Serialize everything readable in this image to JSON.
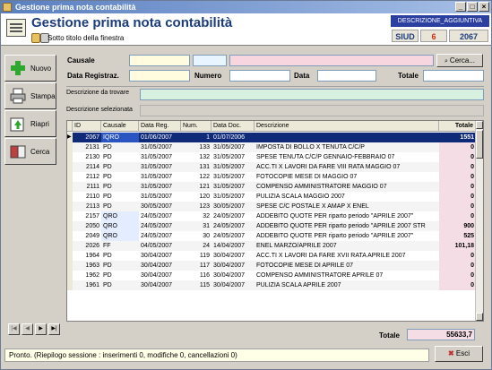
{
  "window": {
    "title": "Gestione prima nota contabilità"
  },
  "header": {
    "title": "Gestione prima nota contabilità",
    "subtitle": "Sotto titolo della finestra",
    "desc_badge": "DESCRIZIONE_AGGIUNTIVA",
    "siud": "SIUD",
    "count": "6",
    "year": "2067"
  },
  "sidebar": {
    "nuovo": "Nuovo",
    "stampa": "Stampa",
    "riapri": "Riapri",
    "cerca": "Cerca"
  },
  "filters": {
    "causale_label": "Causale",
    "cerca_button": "Cerca...",
    "data_registraz_label": "Data Registraz.",
    "numero_label": "Numero",
    "data_label": "Data",
    "totale_label": "Totale",
    "descrizione_da_trovare_label": "Descrizione da trovare",
    "descrizione_selezionata_label": "Descrizione selezionata"
  },
  "grid": {
    "columns": [
      "ID",
      "Causale",
      "Data Reg.",
      "Num.",
      "Data Doc.",
      "Descrizione",
      "Totale"
    ],
    "rows": [
      [
        "2067",
        "IQRO",
        "01/06/2007",
        "1",
        "01/07/2006",
        "",
        "1551"
      ],
      [
        "2131",
        "PD",
        "31/05/2007",
        "133",
        "31/05/2007",
        "IMPOSTA DI BOLLO X TENUTA C/C/P",
        "0"
      ],
      [
        "2130",
        "PD",
        "31/05/2007",
        "132",
        "31/05/2007",
        "SPESE TENUTA C/C/P GENNAIO-FEBBRAIO 07",
        "0"
      ],
      [
        "2114",
        "PD",
        "31/05/2007",
        "131",
        "31/05/2007",
        "ACC.TI X LAVORI DA FARE VIII RATA MAGGIO 07",
        "0"
      ],
      [
        "2112",
        "PD",
        "31/05/2007",
        "122",
        "31/05/2007",
        "FOTOCOPIE MESE DI MAGGIO 07",
        "0"
      ],
      [
        "2111",
        "PD",
        "31/05/2007",
        "121",
        "31/05/2007",
        "COMPENSO AMMINISTRATORE MAGGIO 07",
        "0"
      ],
      [
        "2110",
        "PD",
        "31/05/2007",
        "120",
        "31/05/2007",
        "PULIZIA SCALA MAGGIO  2007",
        "0"
      ],
      [
        "2113",
        "PD",
        "30/05/2007",
        "123",
        "30/05/2007",
        "SPESE C/C POSTALE X AMAP X ENEL",
        "0"
      ],
      [
        "2157",
        "QRO",
        "24/05/2007",
        "32",
        "24/05/2007",
        "ADDEBITO QUOTE PER riparto periodo \"APRILE 2007\"",
        "0"
      ],
      [
        "2050",
        "QRO",
        "24/05/2007",
        "31",
        "24/05/2007",
        "ADDEBITO QUOTE PER riparto periodo \"APRILE 2007 STR",
        "900"
      ],
      [
        "2049",
        "QRO",
        "24/05/2007",
        "30",
        "24/05/2007",
        "ADDEBITO QUOTE PER riparto periodo \"APRILE 2007\"",
        "525"
      ],
      [
        "2026",
        "FF",
        "04/05/2007",
        "24",
        "14/04/2007",
        "ENEL MARZO/APRILE 2007",
        "101,18"
      ],
      [
        "1964",
        "PD",
        "30/04/2007",
        "119",
        "30/04/2007",
        "ACC.TI X LAVORI DA FARE XVII RATA APRILE 2007",
        "0"
      ],
      [
        "1963",
        "PD",
        "30/04/2007",
        "117",
        "30/04/2007",
        "FOTOCOPIE MESE DI APRILE 07",
        "0"
      ],
      [
        "1962",
        "PD",
        "30/04/2007",
        "116",
        "30/04/2007",
        "COMPENSO AMMINISTRATORE APRILE 07",
        "0"
      ],
      [
        "1961",
        "PD",
        "30/04/2007",
        "115",
        "30/04/2007",
        "PULIZIA SCALA APRILE 2007",
        "0"
      ]
    ]
  },
  "footer": {
    "totale_label": "Totale",
    "totale_value": "55633,7",
    "status": "Pronto. (Riepilogo sessione : inserimenti 0, modifiche 0, cancellazioni 0)",
    "esci": "Esci"
  },
  "colors": {
    "selected_row": "#102a7a",
    "causale_field": "#fffce0",
    "pink_field": "#f7d6e0",
    "green_field": "#d8f0e0",
    "totale_col": "#f4dde4"
  }
}
